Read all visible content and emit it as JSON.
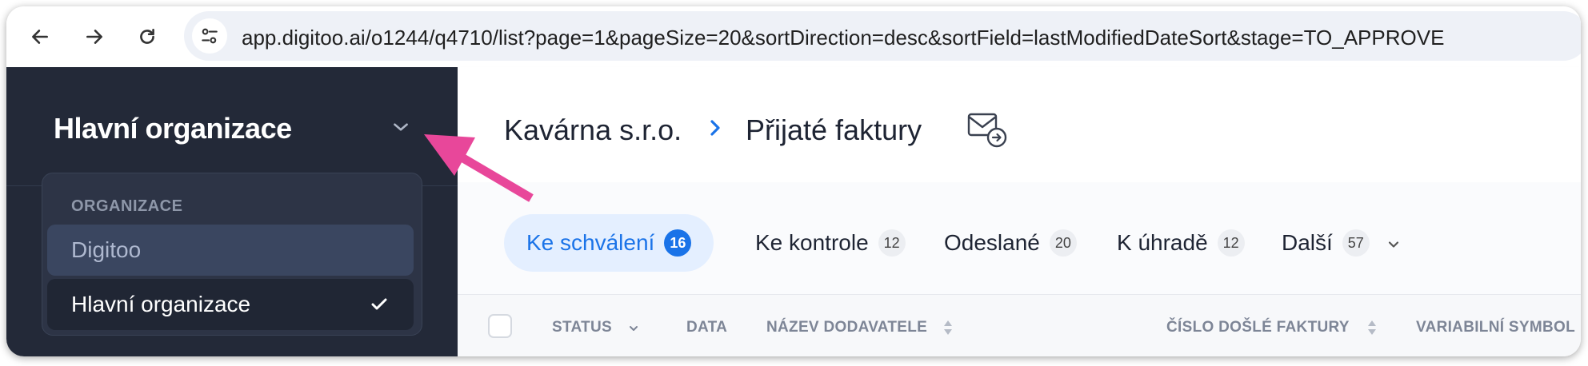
{
  "browser": {
    "url": "app.digitoo.ai/o1244/q4710/list?page=1&pageSize=20&sortDirection=desc&sortField=lastModifiedDateSort&stage=TO_APPROVE",
    "back_icon": "arrow-left-icon",
    "forward_icon": "arrow-right-icon",
    "reload_icon": "reload-icon",
    "site_info_icon": "tune-icon"
  },
  "sidebar": {
    "org_title": "Hlavní organizace",
    "dropdown": {
      "section_label": "ORGANIZACE",
      "items": [
        {
          "label": "Digitoo",
          "selected": false
        },
        {
          "label": "Hlavní organizace",
          "selected": true
        }
      ]
    }
  },
  "header": {
    "company": "Kavárna s.r.o.",
    "page_title": "Přijaté faktury",
    "mail_icon": "mail-forward-icon"
  },
  "tabs": [
    {
      "label": "Ke schválení",
      "count": "16",
      "active": true
    },
    {
      "label": "Ke kontrole",
      "count": "12",
      "active": false
    },
    {
      "label": "Odeslané",
      "count": "20",
      "active": false
    },
    {
      "label": "K úhradě",
      "count": "12",
      "active": false
    },
    {
      "label": "Další",
      "count": "57",
      "active": false
    }
  ],
  "table": {
    "columns": [
      "STATUS",
      "DATA",
      "NÁZEV DODAVATELE",
      "ČÍSLO DOŠLÉ FAKTURY",
      "VARIABILNÍ SYMBOL"
    ]
  },
  "colors": {
    "sidebar_bg": "#232938",
    "accent": "#1a73e8",
    "annotation_arrow": "#e8479a"
  }
}
